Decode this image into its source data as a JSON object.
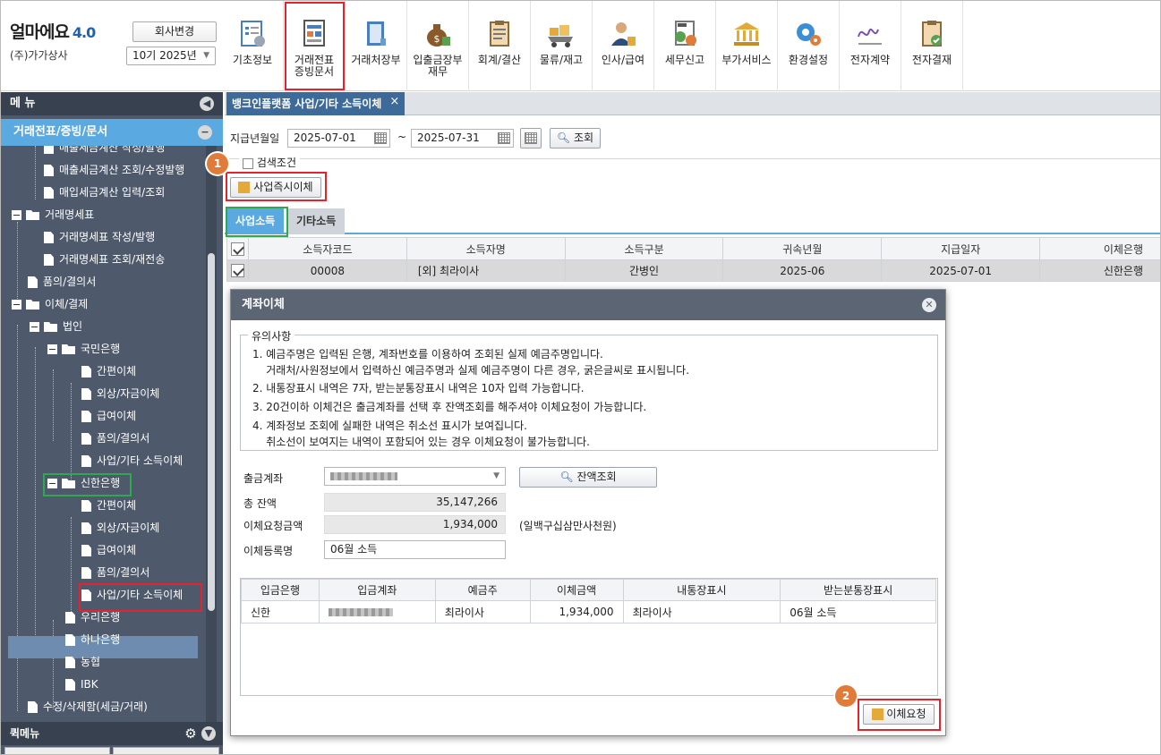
{
  "header": {
    "logo_text": "얼마에요",
    "logo_version": "4.0",
    "company_name": "(주)가가상사",
    "change_company_label": "회사변경",
    "period_value": "10기 2025년"
  },
  "top_menu": [
    {
      "label": "기초정보"
    },
    {
      "label": "거래전표\n증빙문서"
    },
    {
      "label": "거래처장부"
    },
    {
      "label": "입출금장부\n재무"
    },
    {
      "label": "회계/결산"
    },
    {
      "label": "물류/재고"
    },
    {
      "label": "인사/급여"
    },
    {
      "label": "세무신고"
    },
    {
      "label": "부가서비스"
    },
    {
      "label": "환경설정"
    },
    {
      "label": "전자계약"
    },
    {
      "label": "전자결재"
    }
  ],
  "sidebar": {
    "title": "메 뉴",
    "section": "거래전표/증빙/문서",
    "items": [
      {
        "label": "매출세금계산 작성/발행"
      },
      {
        "label": "매출세금계산 조회/수정발행"
      },
      {
        "label": "매입세금계산 입력/조회"
      },
      {
        "label": "거래명세표"
      },
      {
        "label": "거래명세표 작성/발행"
      },
      {
        "label": "거래명세표 조회/재전송"
      },
      {
        "label": "품의/결의서"
      },
      {
        "label": "이체/결제"
      },
      {
        "label": "법인"
      },
      {
        "label": "국민은행"
      },
      {
        "label": "간편이체"
      },
      {
        "label": "외상/자금이체"
      },
      {
        "label": "급여이체"
      },
      {
        "label": "품의/결의서"
      },
      {
        "label": "사업/기타 소득이체"
      },
      {
        "label": "신한은행"
      },
      {
        "label": "간편이체"
      },
      {
        "label": "외상/자금이체"
      },
      {
        "label": "급여이체"
      },
      {
        "label": "품의/결의서"
      },
      {
        "label": "사업/기타 소득이체"
      },
      {
        "label": "우리은행"
      },
      {
        "label": "하나은행"
      },
      {
        "label": "농협"
      },
      {
        "label": "IBK"
      },
      {
        "label": "수정/삭제함(세금/거래)"
      }
    ],
    "quick_menu_title": "퀵메뉴"
  },
  "main": {
    "tab_title": "뱅크인플랫폼 사업/기타 소득이체",
    "pay_date_label": "지급년월일",
    "date_from": "2025-07-01",
    "date_to": "2025-07-31",
    "tilde": "~",
    "search_label": "조회",
    "search_condition_label": "검색조건",
    "instant_transfer_label": "사업즉시이체",
    "subtabs": [
      "사업소득",
      "기타소득"
    ],
    "grid_headers": [
      "소득자코드",
      "소득자명",
      "소득구분",
      "귀속년월",
      "지급일자",
      "이체은행"
    ],
    "grid_rows": [
      [
        "00008",
        "[외] 최라이사",
        "간병인",
        "2025-06",
        "2025-07-01",
        "신한은행"
      ]
    ]
  },
  "badges": {
    "one": "1",
    "two": "2"
  },
  "modal": {
    "title": "계좌이체",
    "notice_title": "유의사항",
    "notices": [
      "1. 예금주명은 입력된 은행, 계좌번호를 이용하여 조회된 실제 예금주명입니다.",
      "    거래처/사원정보에서 입력하신 예금주명과 실제 예금주명이 다른 경우, 굵은글씨로 표시됩니다.",
      "2. 내통장표시 내역은 7자, 받는분통장표시 내역은 10자 입력 가능합니다.",
      "3. 20건이하 이체건은 출금계좌를 선택 후 잔액조회를 해주셔야 이체요청이 가능합니다.",
      "4. 계좌정보 조회에 실패한 내역은 취소선 표시가 보여집니다.",
      "    취소선이 보여지는 내역이 포함되어 있는 경우 이체요청이 불가능합니다."
    ],
    "withdraw_account_label": "출금계좌",
    "balance_check_label": "잔액조회",
    "total_balance_label": "총 잔액",
    "total_balance": "35,147,266",
    "request_amount_label": "이체요청금액",
    "request_amount": "1,934,000",
    "request_amount_korean": "(일백구십삼만사천원)",
    "transfer_name_label": "이체등록명",
    "transfer_name": "06월 소득",
    "table_headers": [
      "입금은행",
      "입금계좌",
      "예금주",
      "이체금액",
      "내통장표시",
      "받는분통장표시"
    ],
    "table_rows": [
      [
        "신한",
        "",
        "최라이사",
        "1,934,000",
        "최라이사",
        "06월 소득"
      ]
    ],
    "request_button": "이체요청"
  }
}
